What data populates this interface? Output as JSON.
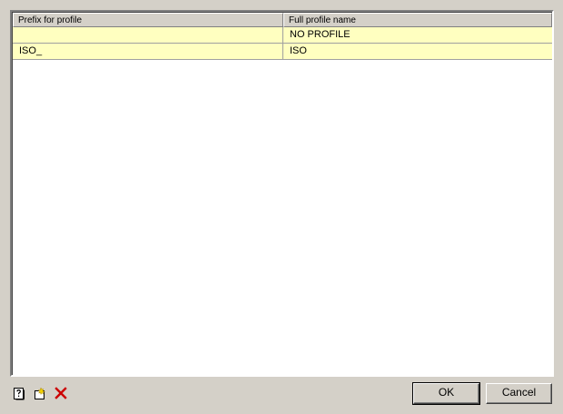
{
  "table": {
    "columns": [
      "Prefix for profile",
      "Full profile name"
    ],
    "rows": [
      {
        "prefix": "",
        "name": "NO PROFILE"
      },
      {
        "prefix": "ISO_",
        "name": "ISO"
      }
    ]
  },
  "toolbar": {
    "icons": [
      "help-icon",
      "new-item-icon",
      "delete-icon"
    ]
  },
  "buttons": {
    "ok_label": "OK",
    "cancel_label": "Cancel"
  },
  "colors": {
    "window_bg": "#d4d0c8",
    "row_highlight": "#ffffc0",
    "delete_red": "#cc0000"
  }
}
